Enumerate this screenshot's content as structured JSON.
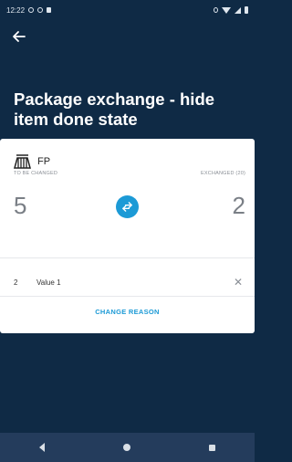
{
  "status_bar": {
    "time": "12:22"
  },
  "header": {
    "title": "Package exchange - hide item done state"
  },
  "card": {
    "item_label": "FP",
    "to_be_changed_label": "TO BE CHANGED",
    "exchanged_label": "EXCHANGED (20)",
    "to_be_changed_value": "5",
    "exchanged_value": "2",
    "row": {
      "qty": "2",
      "value": "Value 1"
    },
    "change_reason_label": "CHANGE REASON"
  },
  "colors": {
    "background": "#0f2a45",
    "accent": "#1c9ad6",
    "nav": "#243c5c"
  },
  "icons": [
    "back-arrow-icon",
    "package-icon",
    "swap-icon",
    "close-icon"
  ]
}
